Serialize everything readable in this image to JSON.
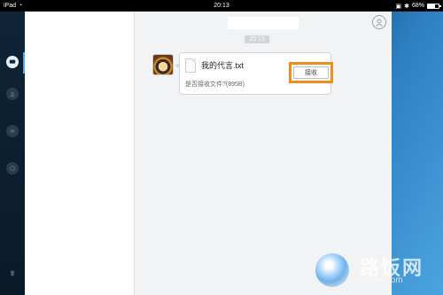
{
  "status_bar": {
    "device": "iPad",
    "time": "20:13",
    "battery": "68%"
  },
  "chat": {
    "timestamp": "20:13",
    "message": {
      "file_name": "我的代言.txt",
      "prompt": "是否接收文件?(895B)",
      "accept_label": "接收"
    }
  },
  "watermark": {
    "name": "路饭网",
    "site": "45fan.com"
  },
  "colors": {
    "highlight": "#f58a1f",
    "accent": "#56a7e8"
  }
}
